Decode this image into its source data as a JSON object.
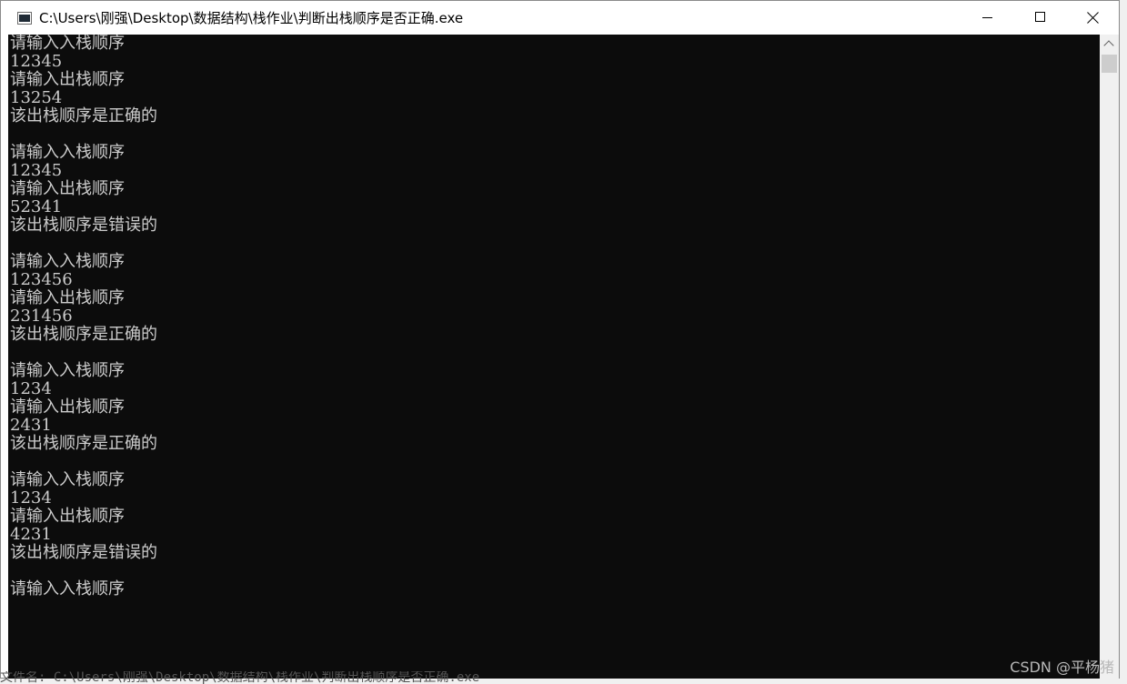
{
  "window": {
    "title": "C:\\Users\\刚强\\Desktop\\数据结构\\栈作业\\判断出栈顺序是否正确.exe",
    "icon": "console-app-icon",
    "buttons": [
      "minimize-icon",
      "maximize-icon",
      "close-icon"
    ]
  },
  "console": {
    "lines": [
      "请输入入栈顺序",
      "12345",
      "请输入出栈顺序",
      "13254",
      "该出栈顺序是正确的",
      "",
      "请输入入栈顺序",
      "12345",
      "请输入出栈顺序",
      "52341",
      "该出栈顺序是错误的",
      "",
      "请输入入栈顺序",
      "123456",
      "请输入出栈顺序",
      "231456",
      "该出栈顺序是正确的",
      "",
      "请输入入栈顺序",
      "1234",
      "请输入出栈顺序",
      "2431",
      "该出栈顺序是正确的",
      "",
      "请输入入栈顺序",
      "1234",
      "请输入出栈顺序",
      "4231",
      "该出栈顺序是错误的",
      "",
      "请输入入栈顺序"
    ],
    "background": "#0c0c0c",
    "text_color": "#cccccc"
  },
  "background_text": "文件名: C:\\Users\\刚强\\Desktop\\数据结构\\栈作业\\判断出栈顺序是否正确.exe",
  "watermark": "CSDN @平杨猪"
}
